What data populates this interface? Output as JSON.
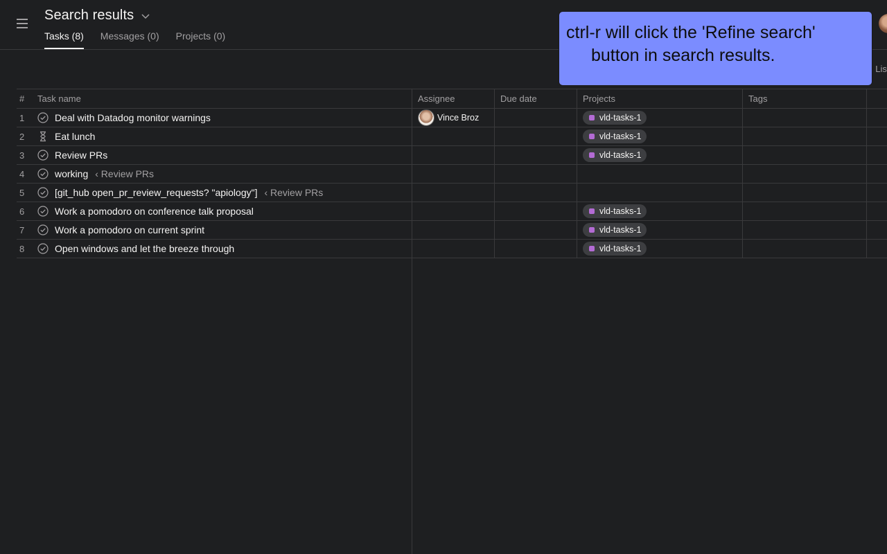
{
  "header": {
    "title": "Search results",
    "tabs": [
      {
        "label": "Tasks (8)",
        "active": true
      },
      {
        "label": "Messages (0)",
        "active": false
      },
      {
        "label": "Projects (0)",
        "active": false
      }
    ],
    "view_hint": ": Lis"
  },
  "tooltip": {
    "line1": "ctrl-r will click the 'Refine search'",
    "line2": "button in search results."
  },
  "table": {
    "columns": {
      "num": "#",
      "name": "Task name",
      "assignee": "Assignee",
      "due": "Due date",
      "projects": "Projects",
      "tags": "Tags"
    },
    "rows": [
      {
        "num": "1",
        "name": "Deal with Datadog monitor warnings",
        "parent": "",
        "icon": "check-circle-icon",
        "assignee": "Vince Broz",
        "project": "vld-tasks-1"
      },
      {
        "num": "2",
        "name": "Eat lunch",
        "parent": "",
        "icon": "hourglass-icon",
        "assignee": "",
        "project": "vld-tasks-1"
      },
      {
        "num": "3",
        "name": "Review PRs",
        "parent": "",
        "icon": "check-circle-icon",
        "assignee": "",
        "project": "vld-tasks-1"
      },
      {
        "num": "4",
        "name": "working",
        "parent": "‹ Review PRs",
        "icon": "check-circle-icon",
        "assignee": "",
        "project": ""
      },
      {
        "num": "5",
        "name": "[git_hub open_pr_review_requests? \"apiology\"]",
        "parent": "‹ Review PRs",
        "icon": "check-circle-icon",
        "assignee": "",
        "project": ""
      },
      {
        "num": "6",
        "name": "Work a pomodoro on conference talk proposal",
        "parent": "",
        "icon": "check-circle-icon",
        "assignee": "",
        "project": "vld-tasks-1"
      },
      {
        "num": "7",
        "name": "Work a pomodoro on current sprint",
        "parent": "",
        "icon": "check-circle-icon",
        "assignee": "",
        "project": "vld-tasks-1"
      },
      {
        "num": "8",
        "name": "Open windows and let the breeze through",
        "parent": "",
        "icon": "check-circle-icon",
        "assignee": "",
        "project": "vld-tasks-1"
      }
    ]
  },
  "colors": {
    "background": "#1e1f21",
    "tooltip": "#7b8cff",
    "project_dot": "#b36bd4"
  }
}
